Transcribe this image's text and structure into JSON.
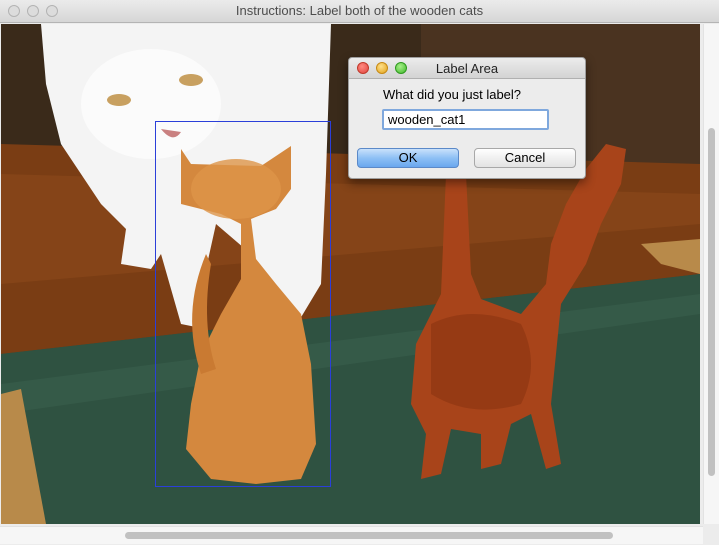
{
  "window": {
    "title": "Instructions: Label both of the wooden cats"
  },
  "dialog": {
    "title": "Label Area",
    "prompt": "What did you just label?",
    "input_value": "wooden_cat1",
    "ok_label": "OK",
    "cancel_label": "Cancel"
  },
  "colors": {
    "bbox": "#2b3fd9",
    "ok_button": "#6aa7ee"
  }
}
